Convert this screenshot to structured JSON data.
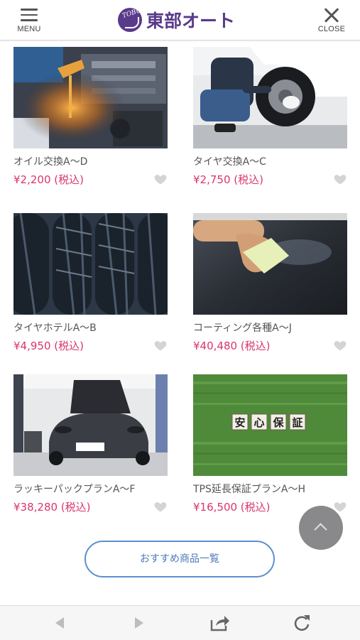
{
  "header": {
    "menu_label": "MENU",
    "close_label": "CLOSE",
    "logo_text": "東部オート",
    "logo_mark_text": "TOBU"
  },
  "products": [
    {
      "title": "オイル交換A〜D",
      "price": "¥2,200 (税込)",
      "image": "engine-oil-photo"
    },
    {
      "title": "タイヤ交換A〜C",
      "price": "¥2,750 (税込)",
      "image": "tire-change-photo"
    },
    {
      "title": "タイヤホテルA〜B",
      "price": "¥4,950 (税込)",
      "image": "tire-tread-photo"
    },
    {
      "title": "コーティング各種A〜J",
      "price": "¥40,480 (税込)",
      "image": "car-coating-photo"
    },
    {
      "title": "ラッキーパックプランA〜F",
      "price": "¥38,280 (税込)",
      "image": "car-garage-photo"
    },
    {
      "title": "TPS延長保証プランA〜H",
      "price": "¥16,500 (税込)",
      "image": "warranty-grass-photo"
    }
  ],
  "warranty_blocks": [
    "安",
    "心",
    "保",
    "証"
  ],
  "recommend_button": "おすすめ商品一覧",
  "toolbar": {
    "icons": [
      "back-arrow-icon",
      "forward-arrow-icon",
      "share-icon",
      "reload-icon"
    ]
  },
  "colors": {
    "brand": "#5a3a8a",
    "price": "#d9356b",
    "accent_button": "#5b8fd0"
  }
}
